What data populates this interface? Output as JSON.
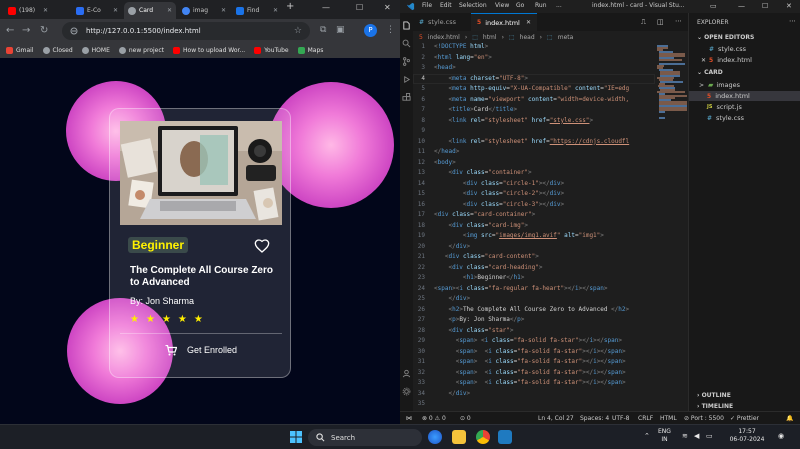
{
  "browser": {
    "tabs": [
      {
        "label": "(198)",
        "color": "#ff0000"
      },
      {
        "label": "E-Co",
        "color": "#2a6df4"
      },
      {
        "label": "Card",
        "color": "#9aa0a6"
      },
      {
        "label": "imag",
        "color": "#4285f4"
      },
      {
        "label": "Find",
        "color": "#1a73e8"
      }
    ],
    "new_tab": "+",
    "url": "http://127.0.0.1:5500/index.html",
    "bookmarks": [
      {
        "label": "Gmail",
        "color": "#ea4335"
      },
      {
        "label": "Closed",
        "color": "#9aa0a6"
      },
      {
        "label": "HOME",
        "color": "#9aa0a6"
      },
      {
        "label": "new project",
        "color": "#9aa0a6"
      },
      {
        "label": "How to upload Wor...",
        "color": "#ff0000"
      },
      {
        "label": "YouTube",
        "color": "#ff0000"
      },
      {
        "label": "Maps",
        "color": "#34a853"
      }
    ],
    "profile_initial": "P"
  },
  "card": {
    "badge": "Beginner",
    "title": "The Complete All Course Zero to Advanced",
    "author": "By: Jon Sharma",
    "stars": [
      "★",
      "★",
      "★",
      "★",
      "★"
    ],
    "button_label": "Get Enrolled",
    "star_color": "#ffee00",
    "circle_color": "#e86fd6"
  },
  "vscode": {
    "menu": [
      "File",
      "Edit",
      "Selection",
      "View",
      "Go",
      "Run",
      "..."
    ],
    "window_title": "index.html - card - Visual Stu...",
    "tabs": [
      {
        "icon": "#",
        "label": "style.css"
      },
      {
        "icon": "5",
        "label": "index.html"
      }
    ],
    "breadcrumb": [
      "index.html",
      "html",
      "head",
      "meta"
    ],
    "code_lines": [
      {
        "n": "1",
        "html": "<span class='pn'>&lt;</span><span class='tg'>!DOCTYPE</span> <span class='at'>html</span><span class='pn'>&gt;</span>"
      },
      {
        "n": "2",
        "html": "<span class='pn'>&lt;</span><span class='tg'>html</span> <span class='at'>lang</span><span class='tx'>=</span><span class='st'>\"en\"</span><span class='pn'>&gt;</span>"
      },
      {
        "n": "3",
        "html": "<span class='pn'>&lt;</span><span class='tg'>head</span><span class='pn'>&gt;</span>"
      },
      {
        "n": "4",
        "html": "    <span class='pn'>&lt;</span><span class='tg'>meta</span> <span class='at'>charset</span><span class='tx'>=</span><span class='st'>\"UTF-8\"</span><span class='pn'>&gt;</span>"
      },
      {
        "n": "5",
        "html": "    <span class='pn'>&lt;</span><span class='tg'>meta</span> <span class='at'>http-equiv</span><span class='tx'>=</span><span class='st'>\"X-UA-Compatible\"</span> <span class='at'>content</span><span class='tx'>=</span><span class='st'>\"IE=edg</span>"
      },
      {
        "n": "6",
        "html": "    <span class='pn'>&lt;</span><span class='tg'>meta</span> <span class='at'>name</span><span class='tx'>=</span><span class='st'>\"viewport\"</span> <span class='at'>content</span><span class='tx'>=</span><span class='st'>\"width=device-width,</span>"
      },
      {
        "n": "7",
        "html": "    <span class='pn'>&lt;</span><span class='tg'>title</span><span class='pn'>&gt;</span><span class='tx'>Card</span><span class='pn'>&lt;/</span><span class='tg'>title</span><span class='pn'>&gt;</span>"
      },
      {
        "n": "8",
        "html": "    <span class='pn'>&lt;</span><span class='tg'>link</span> <span class='at'>rel</span><span class='tx'>=</span><span class='st'>\"stylesheet\"</span> <span class='at'>href</span><span class='tx'>=</span><span class='st'><u>\"style.css\"</u></span><span class='pn'>&gt;</span>"
      },
      {
        "n": "9",
        "html": ""
      },
      {
        "n": "10",
        "html": "    <span class='pn'>&lt;</span><span class='tg'>link</span> <span class='at'>rel</span><span class='tx'>=</span><span class='st'>\"stylesheet\"</span> <span class='at'>href</span><span class='tx'>=</span><span class='st'><u>\"https://cdnjs.cloudfl</u></span>"
      },
      {
        "n": "11",
        "html": "<span class='pn'>&lt;/</span><span class='tg'>head</span><span class='pn'>&gt;</span>"
      },
      {
        "n": "12",
        "html": "<span class='pn'>&lt;</span><span class='tg'>body</span><span class='pn'>&gt;</span>"
      },
      {
        "n": "13",
        "html": "    <span class='pn'>&lt;</span><span class='tg'>div</span> <span class='at'>class</span><span class='tx'>=</span><span class='st'>\"container\"</span><span class='pn'>&gt;</span>"
      },
      {
        "n": "14",
        "html": "        <span class='pn'>&lt;</span><span class='tg'>div</span> <span class='at'>class</span><span class='tx'>=</span><span class='st'>\"circle-1\"</span><span class='pn'>&gt;&lt;/</span><span class='tg'>div</span><span class='pn'>&gt;</span>"
      },
      {
        "n": "15",
        "html": "        <span class='pn'>&lt;</span><span class='tg'>div</span> <span class='at'>class</span><span class='tx'>=</span><span class='st'>\"circle-2\"</span><span class='pn'>&gt;&lt;/</span><span class='tg'>div</span><span class='pn'>&gt;</span>"
      },
      {
        "n": "16",
        "html": "        <span class='pn'>&lt;</span><span class='tg'>div</span> <span class='at'>class</span><span class='tx'>=</span><span class='st'>\"circle-3\"</span><span class='pn'>&gt;&lt;/</span><span class='tg'>div</span><span class='pn'>&gt;</span>"
      },
      {
        "n": "17",
        "html": "<span class='pn'>&lt;</span><span class='tg'>div</span> <span class='at'>class</span><span class='tx'>=</span><span class='st'>\"card-container\"</span><span class='pn'>&gt;</span>"
      },
      {
        "n": "18",
        "html": "    <span class='pn'>&lt;</span><span class='tg'>div</span> <span class='at'>class</span><span class='tx'>=</span><span class='st'>\"card-img\"</span><span class='pn'>&gt;</span>"
      },
      {
        "n": "19",
        "html": "        <span class='pn'>&lt;</span><span class='tg'>img</span> <span class='at'>src</span><span class='tx'>=</span><span class='st'>\"<u>images/img1.avif</u>\"</span> <span class='at'>alt</span><span class='tx'>=</span><span class='st'>\"img1\"</span><span class='pn'>&gt;</span>"
      },
      {
        "n": "20",
        "html": "    <span class='pn'>&lt;/</span><span class='tg'>div</span><span class='pn'>&gt;</span>"
      },
      {
        "n": "21",
        "html": "   <span class='pn'>&lt;</span><span class='tg'>div</span> <span class='at'>class</span><span class='tx'>=</span><span class='st'>\"card-content\"</span><span class='pn'>&gt;</span>"
      },
      {
        "n": "22",
        "html": "    <span class='pn'>&lt;</span><span class='tg'>div</span> <span class='at'>class</span><span class='tx'>=</span><span class='st'>\"card-heading\"</span><span class='pn'>&gt;</span>"
      },
      {
        "n": "23",
        "html": "        <span class='pn'>&lt;</span><span class='tg'>h1</span><span class='pn'>&gt;</span><span class='tx'>Beginner</span><span class='pn'>&lt;/</span><span class='tg'>h1</span><span class='pn'>&gt;</span>"
      },
      {
        "n": "24",
        "html": "<span class='pn'>&lt;</span><span class='tg'>span</span><span class='pn'>&gt;&lt;</span><span class='tg'>i</span> <span class='at'>class</span><span class='tx'>=</span><span class='st'>\"fa-regular fa-heart\"</span><span class='pn'>&gt;&lt;/</span><span class='tg'>i</span><span class='pn'>&gt;&lt;/</span><span class='tg'>span</span><span class='pn'>&gt;</span>"
      },
      {
        "n": "25",
        "html": "    <span class='pn'>&lt;/</span><span class='tg'>div</span><span class='pn'>&gt;</span>"
      },
      {
        "n": "26",
        "html": "    <span class='pn'>&lt;</span><span class='tg'>h2</span><span class='pn'>&gt;</span><span class='tx'>The Complete All Course Zero to Advanced </span><span class='pn'>&lt;/</span><span class='tg'>h2</span><span class='pn'>&gt;</span>"
      },
      {
        "n": "27",
        "html": "    <span class='pn'>&lt;</span><span class='tg'>p</span><span class='pn'>&gt;</span><span class='tx'>By: Jon Sharma</span><span class='pn'>&lt;/</span><span class='tg'>p</span><span class='pn'>&gt;</span>"
      },
      {
        "n": "28",
        "html": "    <span class='pn'>&lt;</span><span class='tg'>div</span> <span class='at'>class</span><span class='tx'>=</span><span class='st'>\"star\"</span><span class='pn'>&gt;</span>"
      },
      {
        "n": "29",
        "html": "      <span class='pn'>&lt;</span><span class='tg'>span</span><span class='pn'>&gt;</span> <span class='pn'>&lt;</span><span class='tg'>i</span> <span class='at'>class</span><span class='tx'>=</span><span class='st'>\"fa-solid fa-star\"</span><span class='pn'>&gt;&lt;/</span><span class='tg'>i</span><span class='pn'>&gt;&lt;/</span><span class='tg'>span</span><span class='pn'>&gt;</span>"
      },
      {
        "n": "30",
        "html": "      <span class='pn'>&lt;</span><span class='tg'>span</span><span class='pn'>&gt;</span>  <span class='pn'>&lt;</span><span class='tg'>i</span> <span class='at'>class</span><span class='tx'>=</span><span class='st'>\"fa-solid fa-star\"</span><span class='pn'>&gt;&lt;/</span><span class='tg'>i</span><span class='pn'>&gt;&lt;/</span><span class='tg'>span</span><span class='pn'>&gt;</span>"
      },
      {
        "n": "31",
        "html": "      <span class='pn'>&lt;</span><span class='tg'>span</span><span class='pn'>&gt;</span>  <span class='pn'>&lt;</span><span class='tg'>i</span> <span class='at'>class</span><span class='tx'>=</span><span class='st'>\"fa-solid fa-star\"</span><span class='pn'>&gt;&lt;/</span><span class='tg'>i</span><span class='pn'>&gt;&lt;/</span><span class='tg'>span</span><span class='pn'>&gt;</span>"
      },
      {
        "n": "32",
        "html": "      <span class='pn'>&lt;</span><span class='tg'>span</span><span class='pn'>&gt;</span>  <span class='pn'>&lt;</span><span class='tg'>i</span> <span class='at'>class</span><span class='tx'>=</span><span class='st'>\"fa-solid fa-star\"</span><span class='pn'>&gt;&lt;/</span><span class='tg'>i</span><span class='pn'>&gt;&lt;/</span><span class='tg'>span</span><span class='pn'>&gt;</span>"
      },
      {
        "n": "33",
        "html": "      <span class='pn'>&lt;</span><span class='tg'>span</span><span class='pn'>&gt;</span>  <span class='pn'>&lt;</span><span class='tg'>i</span> <span class='at'>class</span><span class='tx'>=</span><span class='st'>\"fa-solid fa-star\"</span><span class='pn'>&gt;&lt;/</span><span class='tg'>i</span><span class='pn'>&gt;&lt;/</span><span class='tg'>span</span><span class='pn'>&gt;</span>"
      },
      {
        "n": "34",
        "html": "    <span class='pn'>&lt;/</span><span class='tg'>div</span><span class='pn'>&gt;</span>"
      },
      {
        "n": "35",
        "html": ""
      },
      {
        "n": "36",
        "html": ""
      },
      {
        "n": "37",
        "html": "    <span class='pn'>&lt;/</span><span class='tg'>div</span><span class='pn'>&gt;</span>"
      }
    ],
    "current_line": "4",
    "explorer": {
      "title": "EXPLORER",
      "open_editors": "OPEN EDITORS",
      "open_files": [
        "style.css",
        "index.html"
      ],
      "folder": "CARD",
      "tree": [
        {
          "icon": ">",
          "label": "images"
        },
        {
          "icon": "5",
          "label": "index.html"
        },
        {
          "icon": "JS",
          "label": "script.js"
        },
        {
          "icon": "#",
          "label": "style.css"
        }
      ],
      "outline": "OUTLINE",
      "timeline": "TIMELINE"
    },
    "status": {
      "errors": "⊗ 0 ⚠ 0",
      "warnings": "⊙ 0",
      "position": "Ln 4, Col 27",
      "spaces": "Spaces: 4",
      "encoding": "UTF-8",
      "eol": "CRLF",
      "language": "HTML",
      "port": "⊘ Port : 5500",
      "prettier": "✓ Prettier"
    }
  },
  "taskbar": {
    "search": "Search",
    "lang_top": "ENG",
    "lang_bottom": "IN",
    "time": "17:57",
    "date": "06-07-2024"
  }
}
